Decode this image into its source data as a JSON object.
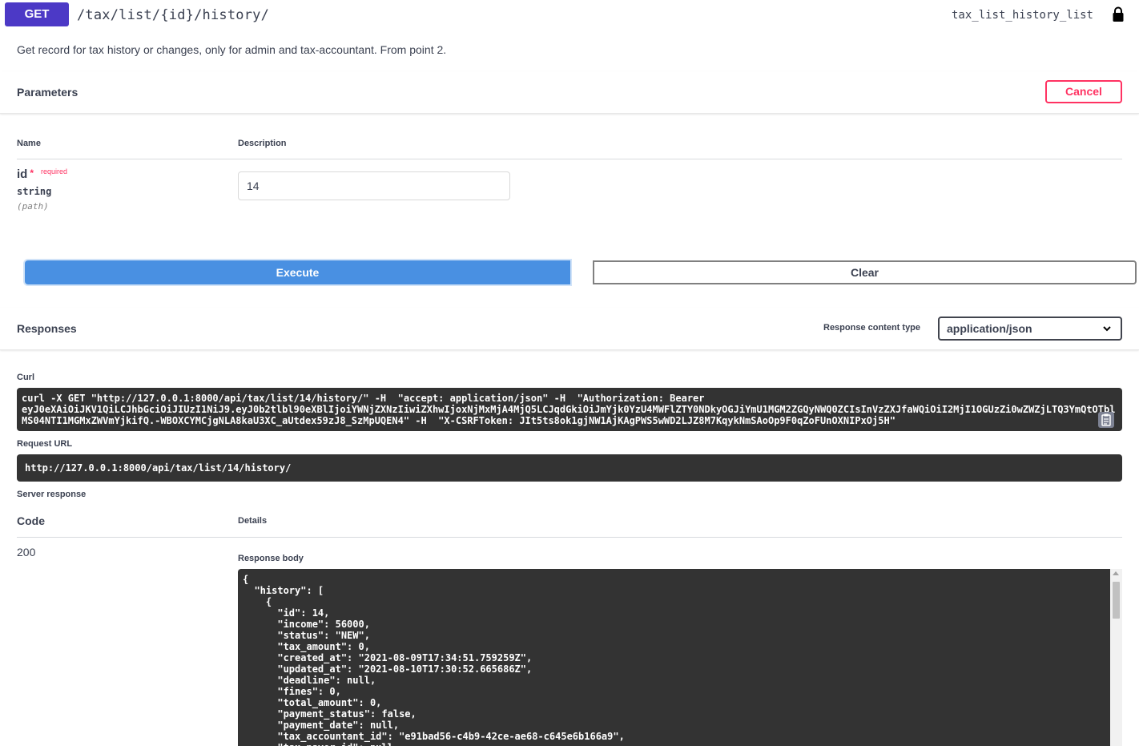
{
  "operation": {
    "method": "GET",
    "path": "/tax/list/{id}/history/",
    "operation_id": "tax_list_history_list",
    "description": "Get record for tax history or changes, only for admin and tax-accountant. From point 2."
  },
  "parameters": {
    "title": "Parameters",
    "cancel_label": "Cancel",
    "col_name": "Name",
    "col_description": "Description",
    "items": [
      {
        "name": "id",
        "required_star": "*",
        "required_text": "required",
        "type": "string",
        "in": "(path)",
        "value": "14"
      }
    ]
  },
  "actions": {
    "execute_label": "Execute",
    "clear_label": "Clear"
  },
  "responses": {
    "title": "Responses",
    "content_type_label": "Response content type",
    "content_type_value": "application/json"
  },
  "curl": {
    "label": "Curl",
    "lines": [
      "curl -X GET \"http://127.0.0.1:8000/api/tax/list/14/history/\" -H  \"accept: application/json\" -H  \"Authorization: Bearer ",
      "eyJ0eXAiOiJKV1QiLCJhbGciOiJIUzI1NiJ9.eyJ0b2tlbl90eXBlIjoiYWNjZXNzIiwiZXhwIjoxNjMxMjA4MjQ5LCJqdGkiOiJmYjk0YzU4MWFlZTY0NDkyOGJiYmU1MGM2ZGQyNWQ0ZCIsInVzZXJfaWQiOiI2MjI1OGUzZi0wZWZjLTQ3YmQtOTbl",
      "MS04NTI1MGMxZWVmYjkifQ.-WBOXCYMCjgNLA8kaU3XC_aUtdex59zJ8_SzMpUQEN4\" -H  \"X-CSRFToken: JIt5ts8ok1gjNW1AjKAgPWS5wWD2LJZ8M7KqykNmSAoOp9F0qZoFUnOXNIPxOj5H\""
    ]
  },
  "request_url": {
    "label": "Request URL",
    "value": "http://127.0.0.1:8000/api/tax/list/14/history/"
  },
  "server_response": {
    "label": "Server response",
    "code_header": "Code",
    "details_header": "Details",
    "code": "200",
    "body_label": "Response body",
    "body_lines": [
      "{",
      "  \"history\": [",
      "    {",
      "      \"id\": 14,",
      "      \"income\": 56000,",
      "      \"status\": \"NEW\",",
      "      \"tax_amount\": 0,",
      "      \"created_at\": \"2021-08-09T17:34:51.759259Z\",",
      "      \"updated_at\": \"2021-08-10T17:30:52.665686Z\",",
      "      \"deadline\": null,",
      "      \"fines\": 0,",
      "      \"total_amount\": 0,",
      "      \"payment_status\": false,",
      "      \"payment_date\": null,",
      "      \"tax_accountant_id\": \"e91bad56-c4b9-42ce-ae68-c645e6b166a9\",",
      "      \"tax_payer_id\": null,"
    ]
  },
  "icons": {
    "lock": "lock-icon",
    "copy": "copy-icon",
    "dropdown": "chevron-down-icon"
  },
  "colors": {
    "method_get": "#4c39c6",
    "execute": "#4990e2",
    "cancel": "#ff3262",
    "code_bg": "#333333"
  }
}
